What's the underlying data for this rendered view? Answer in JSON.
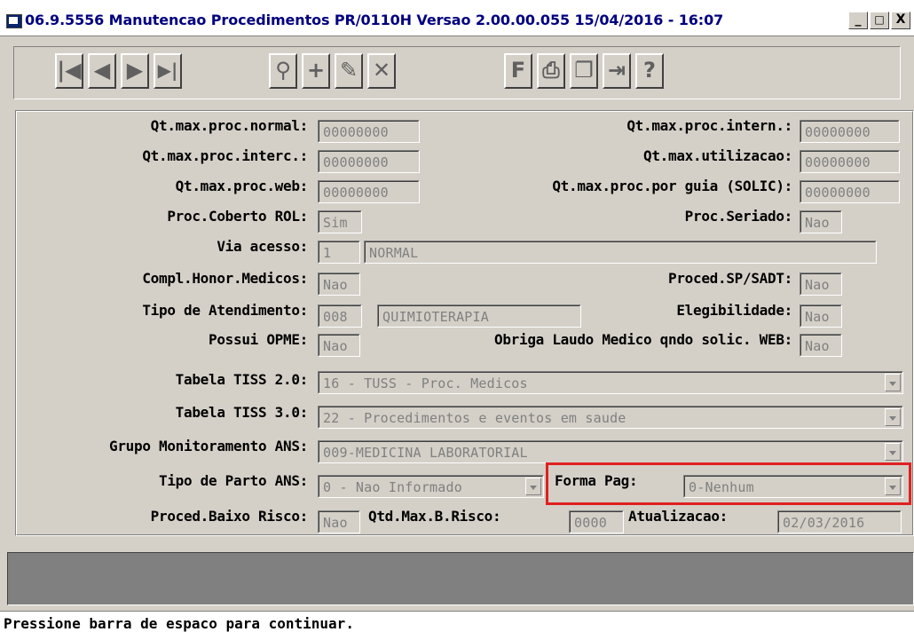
{
  "window": {
    "title": "06.9.5556 Manutencao Procedimentos PR/0110H Versao 2.00.00.055 15/04/2016 - 16:07",
    "controls": [
      "_",
      "□",
      "X"
    ]
  },
  "toolbar": {
    "buttons": [
      {
        "name": "first-record",
        "glyph": "|◀"
      },
      {
        "name": "previous-record",
        "glyph": "◀"
      },
      {
        "name": "next-record",
        "glyph": "▶"
      },
      {
        "name": "last-record",
        "glyph": "▶|"
      },
      {
        "name": "search",
        "glyph": "⚲"
      },
      {
        "name": "add",
        "glyph": "+"
      },
      {
        "name": "edit",
        "glyph": "✎"
      },
      {
        "name": "delete",
        "glyph": "✕"
      },
      {
        "name": "filter",
        "glyph": "F"
      },
      {
        "name": "print",
        "glyph": "⎙"
      },
      {
        "name": "copy",
        "glyph": "❐"
      },
      {
        "name": "exit",
        "glyph": "⇥"
      },
      {
        "name": "help",
        "glyph": "?"
      }
    ]
  },
  "form": {
    "qt_max_proc_normal": {
      "label": "Qt.max.proc.normal:",
      "value": "00000000"
    },
    "qt_max_proc_intern": {
      "label": "Qt.max.proc.intern.:",
      "value": "00000000"
    },
    "qt_max_proc_interc": {
      "label": "Qt.max.proc.interc.:",
      "value": "00000000"
    },
    "qt_max_utilizacao": {
      "label": "Qt.max.utilizacao:",
      "value": "00000000"
    },
    "qt_max_proc_web": {
      "label": "Qt.max.proc.web:",
      "value": "00000000"
    },
    "qt_max_proc_por_guia": {
      "label": "Qt.max.proc.por guia (SOLIC):",
      "value": "00000000"
    },
    "proc_coberto_rol": {
      "label": "Proc.Coberto ROL:",
      "value": "Sim"
    },
    "proc_seriado": {
      "label": "Proc.Seriado:",
      "value": "Nao"
    },
    "via_acesso": {
      "label": "Via acesso:",
      "code": "1",
      "description": "NORMAL"
    },
    "compl_honor_medicos": {
      "label": "Compl.Honor.Medicos:",
      "value": "Nao"
    },
    "proced_sp_sadt": {
      "label": "Proced.SP/SADT:",
      "value": "Nao"
    },
    "tipo_atendimento": {
      "label": "Tipo de Atendimento:",
      "code": "008",
      "description": "QUIMIOTERAPIA"
    },
    "elegibilidade": {
      "label": "Elegibilidade:",
      "value": "Nao"
    },
    "possui_opme": {
      "label": "Possui OPME:",
      "value": "Nao"
    },
    "obriga_laudo": {
      "label": "Obriga Laudo Medico qndo solic. WEB:",
      "value": "Nao"
    },
    "tabela_tiss_20": {
      "label": "Tabela TISS 2.0:",
      "value": "16 - TUSS - Proc. Medicos"
    },
    "tabela_tiss_30": {
      "label": "Tabela TISS 3.0:",
      "value": "22 - Procedimentos e eventos em saude"
    },
    "grupo_monitoramento": {
      "label": "Grupo Monitoramento ANS:",
      "value": "009-MEDICINA LABORATORIAL"
    },
    "tipo_parto": {
      "label": "Tipo de Parto ANS:",
      "value": "0 - Nao Informado"
    },
    "forma_pag": {
      "label": "Forma Pag:",
      "value": "0-Nenhum"
    },
    "proced_baixo_risco": {
      "label": "Proced.Baixo Risco:",
      "value": "Nao"
    },
    "qtd_max_b_risco": {
      "label": "Qtd.Max.B.Risco:",
      "value": "0000"
    },
    "atualizacao": {
      "label": "Atualizacao:",
      "value": "02/03/2016"
    }
  },
  "status": {
    "message": "Pressione barra de espaco para continuar."
  },
  "colors": {
    "highlight": "#e02020",
    "background": "#d4d0c8"
  }
}
